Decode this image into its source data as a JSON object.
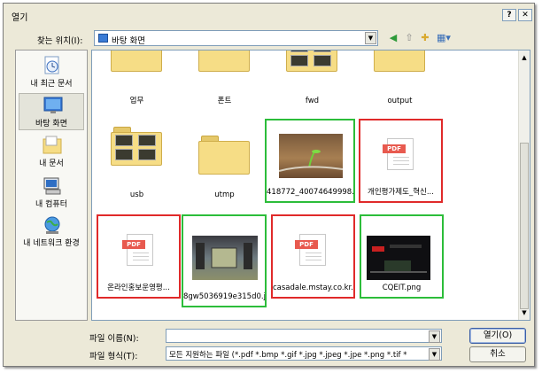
{
  "window": {
    "title": "열기"
  },
  "lookin": {
    "label": "찾는 위치(I):",
    "value": "바탕 화면"
  },
  "places": [
    {
      "label": "내 최근 문서",
      "icon": "recent-documents-icon"
    },
    {
      "label": "바탕 화면",
      "icon": "desktop-icon",
      "selected": true
    },
    {
      "label": "내 문서",
      "icon": "my-documents-icon"
    },
    {
      "label": "내 컴퓨터",
      "icon": "my-computer-icon"
    },
    {
      "label": "내 네트워크 환경",
      "icon": "network-icon"
    }
  ],
  "files": [
    {
      "name": "업무",
      "type": "folder"
    },
    {
      "name": "폰트",
      "type": "folder"
    },
    {
      "name": "fwd",
      "type": "folder-photos"
    },
    {
      "name": "output",
      "type": "folder"
    },
    {
      "name": "usb",
      "type": "folder-photos"
    },
    {
      "name": "utmp",
      "type": "folder"
    },
    {
      "name": "418772_40074649998...",
      "type": "image",
      "highlight": "green"
    },
    {
      "name": "개인평가제도_혁신...",
      "type": "pdf",
      "highlight": "red"
    },
    {
      "name": "온라인홍보운영평...",
      "type": "pdf",
      "highlight": "red"
    },
    {
      "name": "8gw5036919e315d0.jpg",
      "type": "image",
      "highlight": "green"
    },
    {
      "name": "casadale.mstay.co.kr...",
      "type": "pdf",
      "highlight": "red"
    },
    {
      "name": "CQEIT.png",
      "type": "image",
      "highlight": "green"
    }
  ],
  "filename": {
    "label": "파일 이름(N):",
    "value": ""
  },
  "filetype": {
    "label": "파일 형식(T):",
    "value": "모든 지원하는 파일 (*.pdf *.bmp *.gif *.jpg *.jpeg *.jpe *.png *.tif *"
  },
  "buttons": {
    "open": "열기(O)",
    "cancel": "취소"
  },
  "colors": {
    "highlight_red": "#e02a2a",
    "highlight_green": "#2cbd3a"
  }
}
